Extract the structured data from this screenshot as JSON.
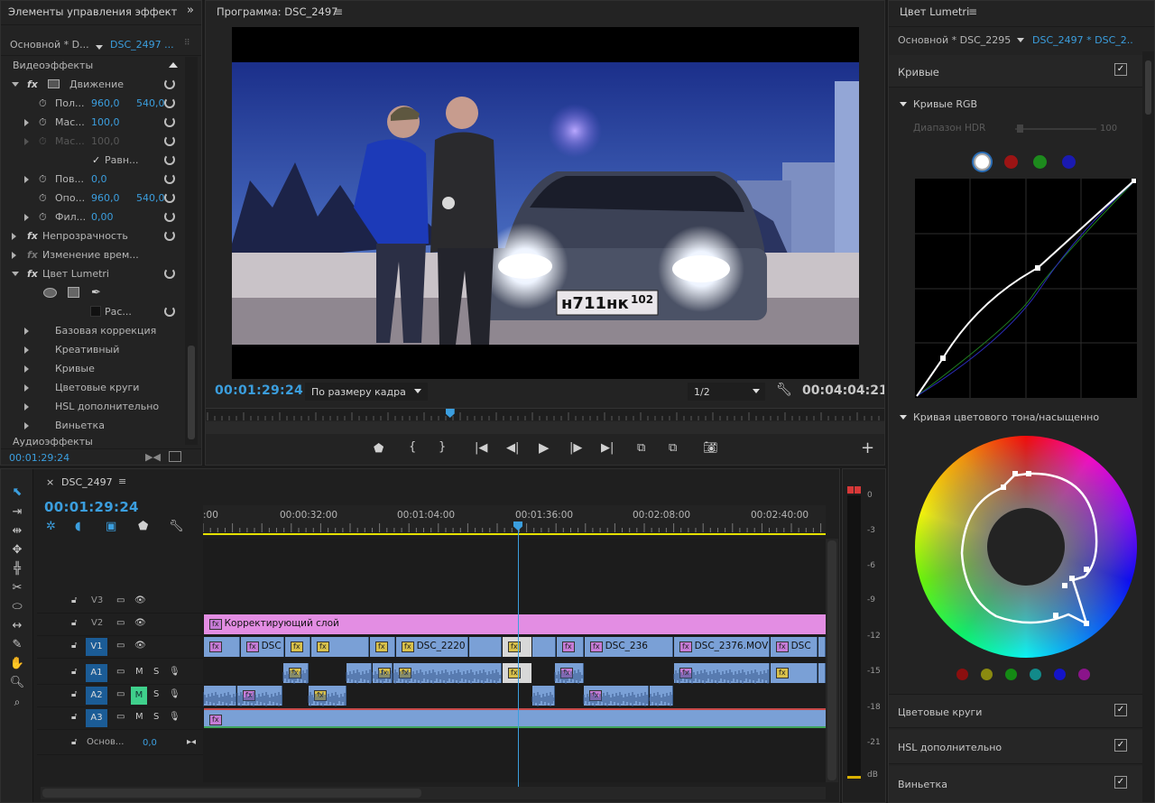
{
  "effect_controls": {
    "title": "Элементы управления эффектам",
    "expand_icon": "double-chevron-icon",
    "tab_master": "Основной * D...",
    "tab_clip": "DSC_2497 ...",
    "video_effects": "Видеоэффекты",
    "motion": "Движение",
    "position_label": "Пол...",
    "position_x": "960,0",
    "position_y": "540,0",
    "scale_label": "Мас...",
    "scale_value": "100,0",
    "scale_w_label": "Мас...",
    "scale_w_value": "100,0",
    "uniform_label": "Равн...",
    "rotation_label": "Пов...",
    "rotation_value": "0,0",
    "anchor_label": "Опо...",
    "anchor_x": "960,0",
    "anchor_y": "540,0",
    "flicker_label": "Фил...",
    "flicker_value": "0,00",
    "opacity": "Непрозрачность",
    "time_remap": "Изменение врем...",
    "lumetri": "Цвет Lumetri",
    "mask_label": "Рас...",
    "sections": [
      "Базовая коррекция",
      "Креативный",
      "Кривые",
      "Цветовые круги",
      "HSL дополнительно",
      "Виньетка"
    ],
    "audio_effects": "Аудиоэффекты",
    "timecode": "00:01:29:24"
  },
  "program": {
    "title": "Программа: DSC_2497",
    "timecode_left": "00:01:29:24",
    "fit": "По размеру кадра",
    "resolution": "1/2",
    "timecode_right": "00:04:04:21",
    "plate": "н711нк",
    "plate_region": "102",
    "playhead_fraction": 0.36
  },
  "lumetri": {
    "title": "Цвет Lumetri",
    "tab_master": "Основной * DSC_2295...",
    "tab_clip": "DSC_2497 * DSC_2...",
    "curves": "Кривые",
    "rgb_curves": "Кривые RGB",
    "hdr_range": "Диапазон HDR",
    "hdr_value": "100",
    "hue_sat": "Кривая цветового тона/насыщенно",
    "color_wheels": "Цветовые круги",
    "hsl": "HSL дополнительно",
    "vignette": "Виньетка",
    "channel_colors": [
      "#ffffff",
      "#9c1414",
      "#1d8a1d",
      "#1a1ab0"
    ],
    "hue_dots": [
      "#8b0f0f",
      "#8a8a10",
      "#148a14",
      "#128a8a",
      "#1414c8",
      "#8a148a"
    ]
  },
  "timeline": {
    "tab": "DSC_2497",
    "timecode": "00:01:29:24",
    "ruler": [
      ":00",
      "00:00:32:00",
      "00:01:04:00",
      "00:01:36:00",
      "00:02:08:00",
      "00:02:40:00"
    ],
    "tracks": {
      "v3": "V3",
      "v2": "V2",
      "v1": "V1",
      "a1": "A1",
      "a2": "A2",
      "a3": "A3",
      "master": "Основ...",
      "master_value": "0,0"
    },
    "adjustment_layer": "Корректирующий слой",
    "clips": [
      "DSC",
      "DSC_2220",
      "DSC_236",
      "DSC_2376.MOV",
      "DSC"
    ],
    "m": "M",
    "s": "S"
  },
  "meter": {
    "labels": [
      "0",
      "-3",
      "-6",
      "-9",
      "-12",
      "-15",
      "-18",
      "-21",
      "dB"
    ]
  },
  "colors": {
    "accent": "#3b9ede",
    "adjustment": "#e38de3",
    "clip": "#7aa0d6"
  }
}
